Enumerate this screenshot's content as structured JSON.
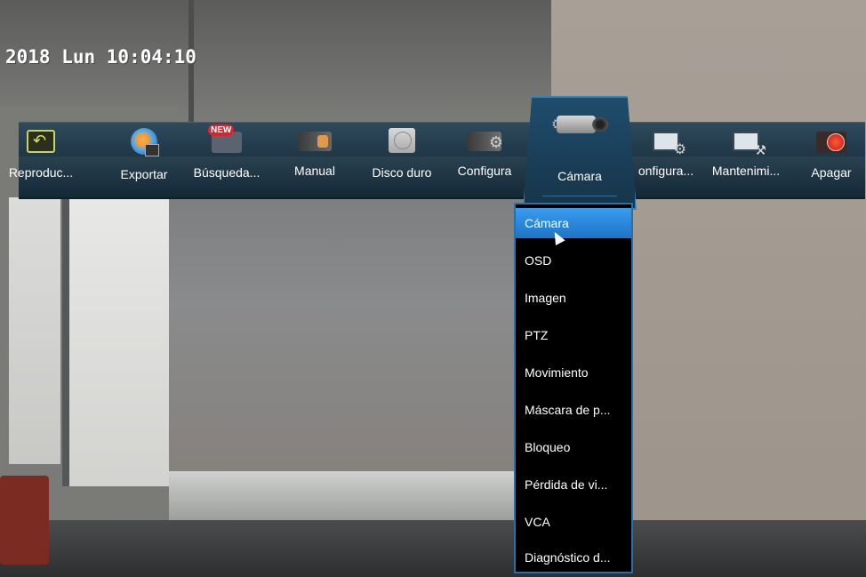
{
  "timestamp": {
    "prefix": "2018 Lun 10:04",
    "seconds": ":10"
  },
  "menubar": {
    "items": [
      {
        "label": "Reproduc...",
        "icon": "playback-icon"
      },
      {
        "label": "Exportar",
        "icon": "export-disc-icon"
      },
      {
        "label": "Búsqueda...",
        "icon": "new-search-icon",
        "badge": "NEW"
      },
      {
        "label": "Manual",
        "icon": "manual-record-icon"
      },
      {
        "label": "Disco duro",
        "icon": "hard-disk-icon"
      },
      {
        "label": "Configura",
        "icon": "record-config-icon"
      },
      {
        "label": "Cámara",
        "icon": "camera-icon",
        "active": true
      },
      {
        "label": "onfigura...",
        "icon": "system-config-icon"
      },
      {
        "label": "Mantenimi...",
        "icon": "maintenance-icon"
      },
      {
        "label": "Apagar",
        "icon": "power-icon"
      }
    ]
  },
  "submenu": {
    "items": [
      {
        "label": "Cámara",
        "selected": true
      },
      {
        "label": "OSD"
      },
      {
        "label": "Imagen"
      },
      {
        "label": "PTZ"
      },
      {
        "label": "Movimiento"
      },
      {
        "label": "Máscara de p..."
      },
      {
        "label": "Bloqueo"
      },
      {
        "label": "Pérdida de vi..."
      },
      {
        "label": "VCA"
      },
      {
        "label": "Diagnóstico d..."
      }
    ]
  },
  "colors": {
    "menubar": "#1f3747",
    "active_border": "#3c7fb1",
    "selected_item": "#2a88dc",
    "submenu_bg": "#000000"
  }
}
